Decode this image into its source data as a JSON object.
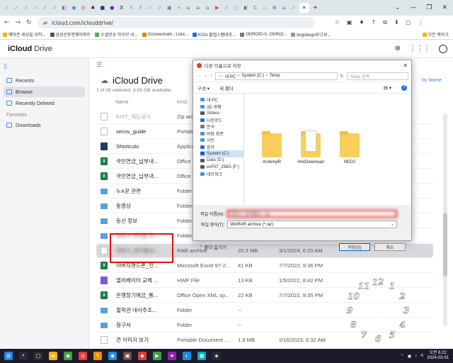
{
  "browser": {
    "tabs": [
      {
        "color": "#4caf50",
        "glyph": "✓"
      },
      {
        "color": "#4caf50",
        "glyph": "✓"
      },
      {
        "color": "#4caf50",
        "glyph": "✓"
      },
      {
        "color": "#4caf50",
        "glyph": "✓"
      },
      {
        "color": "#4caf50",
        "glyph": "✓"
      },
      {
        "color": "#4caf50",
        "glyph": "✓"
      },
      {
        "color": "#777",
        "glyph": "◧"
      },
      {
        "color": "#1877f2",
        "glyph": "◉"
      },
      {
        "color": "#e53935",
        "glyph": "◎"
      },
      {
        "color": "#2b2b2b",
        "glyph": "♣"
      },
      {
        "color": "#1b3a8a",
        "glyph": "■"
      },
      {
        "color": "#7b1fa2",
        "glyph": "●"
      },
      {
        "color": "#111",
        "glyph": "X"
      },
      {
        "color": "#1877f2",
        "glyph": "f"
      },
      {
        "color": "#1877f2",
        "glyph": "f"
      },
      {
        "color": "#4caf50",
        "glyph": "✓"
      },
      {
        "color": "#4caf50",
        "glyph": "✓"
      },
      {
        "color": "#777",
        "glyph": "▣"
      },
      {
        "color": "#2196f3",
        "glyph": "+"
      },
      {
        "color": "#555",
        "glyph": "⌂"
      },
      {
        "color": "#555",
        "glyph": "⌂"
      },
      {
        "color": "#555",
        "glyph": "⌂"
      },
      {
        "color": "#e53935",
        "glyph": "▶"
      },
      {
        "color": "#4caf50",
        "glyph": "✓"
      },
      {
        "color": "#2196f3",
        "glyph": "○"
      },
      {
        "color": "#555",
        "glyph": "◐"
      },
      {
        "color": "#1976d2",
        "glyph": "C"
      },
      {
        "color": "#f9a825",
        "glyph": "⌂"
      },
      {
        "color": "#1976d2",
        "glyph": "⊕"
      },
      {
        "color": "#555",
        "glyph": "⌂"
      },
      {
        "color": "#4caf50",
        "glyph": "✓"
      },
      {
        "color": "#222",
        "glyph": "✕"
      }
    ],
    "new_tab_glyph": "+",
    "window_controls": [
      "⌄",
      "—",
      "❐",
      "✕"
    ],
    "url": "icloud.com/iclouddrive/",
    "nav": {
      "back": "←",
      "forward": "→",
      "reload": "↻",
      "site_info": "⇌"
    },
    "nav_right": [
      "☆",
      "▣",
      "♦",
      "↑",
      "⧉",
      "⬇",
      "◻",
      "⋮"
    ],
    "bookmarks": [
      {
        "label": "메타몬 세상을 위하...",
        "color": "#f4b400"
      },
      {
        "label": "삼성산토판체아파트",
        "color": "#555"
      },
      {
        "label": "소셜방송 하이브 서...",
        "color": "#4caf50"
      },
      {
        "label": "Grooveshark - Liste...",
        "color": "#f57c00"
      },
      {
        "label": "KISA 불법스팸대응...",
        "color": "#1976d2"
      },
      {
        "label": "ODROID-X, ODROI...",
        "color": "#777"
      },
      {
        "label": "bogobogo보고보...",
        "color": "#999"
      },
      {
        "label": "모든 북마크",
        "color": "#f4b400"
      }
    ]
  },
  "icloud": {
    "logo_apple": "",
    "logo_text": "iCloud",
    "logo_drive": "Drive",
    "header_icons": [
      "⊕",
      "⋮⋮⋮",
      "◯"
    ],
    "sidebar": {
      "items": [
        {
          "label": "Recents",
          "color": "#3b8ee0",
          "selected": false
        },
        {
          "label": "Browse",
          "color": "#3b8ee0",
          "selected": true
        },
        {
          "label": "Recently Deleted",
          "color": "#3b8ee0",
          "selected": false
        }
      ],
      "favorites_label": "Favorites",
      "favorites": [
        {
          "label": "Downloads",
          "color": "#3b8ee0"
        }
      ]
    },
    "toolbar_glyph": "☰",
    "title": "iCloud Drive",
    "subtitle": "1 of 28 selected, 3.65 GB available",
    "sort_label": "by Name",
    "columns": {
      "name": "Name",
      "kind": "Kind"
    },
    "rows": [
      {
        "name": "KIST_재능공시",
        "kind": "Zip arc...",
        "size": "",
        "date": "",
        "icon": "doc",
        "blur": false,
        "faded": true
      },
      {
        "name": "secsv_guide",
        "kind": "Portable...",
        "size": "",
        "date": "",
        "icon": "doc",
        "blur": false
      },
      {
        "name": "Shortcuts",
        "kind": "Applica...",
        "size": "",
        "date": "",
        "icon": "short",
        "blur": false
      },
      {
        "name": "국민연금_납부내...",
        "kind": "Office ...",
        "size": "",
        "date": "",
        "icon": "excel",
        "blur": false
      },
      {
        "name": "국민연금_납부내...",
        "kind": "Office ...",
        "size": "",
        "date": "",
        "icon": "excel",
        "blur": false
      },
      {
        "name": "누X꾼 관련",
        "kind": "Folder",
        "size": "",
        "date": "",
        "icon": "folder",
        "blur": false
      },
      {
        "name": "동영상",
        "kind": "Folder",
        "size": "",
        "date": "",
        "icon": "folder",
        "blur": false
      },
      {
        "name": "등산 정보",
        "kind": "Folder",
        "size": "",
        "date": "",
        "icon": "folder",
        "blur": false
      },
      {
        "name": "제목시 면미를 추...",
        "kind": "Folder",
        "size": "--",
        "date": "",
        "icon": "folder",
        "blur": true
      },
      {
        "name": "제목시_원미를30...",
        "kind": "RAR archive",
        "size": "20.3 MB",
        "date": "3/1/2024, 6:20 AM",
        "icon": "doc",
        "blur": true,
        "selected": true
      },
      {
        "name": "아버지핸드폰_전...",
        "kind": "Microsoft Excel 97-2...",
        "size": "41 KB",
        "date": "7/7/2022, 9:36 PM",
        "icon": "excel",
        "blur": false
      },
      {
        "name": "엘리베이터 교체 ...",
        "kind": "HWP File",
        "size": "13 KB",
        "date": "1/5/2022, 8:42 PM",
        "icon": "hwp",
        "blur": false
      },
      {
        "name": "은행정기예금_통...",
        "kind": "Office Open XML sp...",
        "size": "22 KB",
        "date": "7/7/2022, 9:35 PM",
        "icon": "excel",
        "blur": false
      },
      {
        "name": "철학관 내사주조...",
        "kind": "Folder",
        "size": "--",
        "date": "",
        "icon": "folder",
        "blur": false
      },
      {
        "name": "청구서",
        "kind": "Folder",
        "size": "--",
        "date": "",
        "icon": "folder",
        "blur": false
      },
      {
        "name": "큰 이미지 보기",
        "kind": "Portable Document ...",
        "size": "1.8 MB",
        "date": "2/16/2023, 6:32 AM",
        "icon": "doc",
        "blur": false
      }
    ]
  },
  "dialog": {
    "title": "다른 이름으로 저장",
    "close": "✕",
    "path_parts": [
      "내 PC",
      "System (C:)",
      "Temp"
    ],
    "search_placeholder": "Temp 검색",
    "toolbar": {
      "organize": "구성 ▾",
      "new_folder": "새 폴더"
    },
    "tree": [
      {
        "label": "내 PC",
        "color": "#4a90d9",
        "selected": false
      },
      {
        "label": "3D 개체",
        "color": "#4a90d9",
        "selected": false
      },
      {
        "label": "Videos",
        "color": "#555",
        "selected": false
      },
      {
        "label": "다운로드",
        "color": "#2a6fb5",
        "selected": false
      },
      {
        "label": "문서",
        "color": "#777",
        "selected": false
      },
      {
        "label": "바탕 화면",
        "color": "#4a90d9",
        "selected": false
      },
      {
        "label": "사진",
        "color": "#4a90d9",
        "selected": false
      },
      {
        "label": "음악",
        "color": "#2a6fb5",
        "selected": false
      },
      {
        "label": "System (C:)",
        "color": "#1a5fa5",
        "selected": true
      },
      {
        "label": "Data (D:)",
        "color": "#555",
        "selected": false
      },
      {
        "label": "exFAT_256G (F:)",
        "color": "#555",
        "selected": false
      },
      {
        "label": "네트워크",
        "color": "#4a90d9",
        "selected": false
      }
    ],
    "folders": [
      {
        "label": "AUtempR",
        "paper": false
      },
      {
        "label": "HncDownload",
        "paper": true
      },
      {
        "label": "NEO2",
        "paper": false
      }
    ],
    "filename_label": "파일 이름(N):",
    "filename_value": "제목시_원미를30...rar",
    "filetype_label": "파일 형식(T):",
    "filetype_value": "WinRAR archive (*.rar)",
    "hide_folders": "폴더 숨기기",
    "save_button": "저장(S)",
    "cancel_button": "취소"
  },
  "clock": {
    "numbers": [
      "12",
      "1",
      "2",
      "3",
      "4",
      "5",
      "6",
      "7",
      "8",
      "9",
      "10",
      "11"
    ],
    "hour": 6,
    "minute": 22
  },
  "taskbar": {
    "icons": [
      {
        "color": "#1e88e5",
        "glyph": "⊞"
      },
      {
        "color": "#2b2b2b",
        "glyph": "⌕"
      },
      {
        "color": "#2b2b2b",
        "glyph": "▢"
      },
      {
        "color": "#ffb300",
        "glyph": "▰"
      },
      {
        "color": "#43a047",
        "glyph": "◉"
      },
      {
        "color": "#e53935",
        "glyph": "◎"
      },
      {
        "color": "#fb8c00",
        "glyph": "✎"
      },
      {
        "color": "#1e88e5",
        "glyph": "◉"
      },
      {
        "color": "#6d4c41",
        "glyph": "▣"
      },
      {
        "color": "#e53935",
        "glyph": "◆"
      },
      {
        "color": "#43a047",
        "glyph": "▶"
      },
      {
        "color": "#8e24aa",
        "glyph": "★"
      },
      {
        "color": "#1e88e5",
        "glyph": "◐"
      },
      {
        "color": "#00acc1",
        "glyph": "▦"
      },
      {
        "color": "#2b2b2b",
        "glyph": "◈"
      }
    ],
    "tray": [
      "⌃",
      "▣",
      "♪",
      "A"
    ],
    "time": "오전 6:22",
    "date": "2024-03-01"
  }
}
